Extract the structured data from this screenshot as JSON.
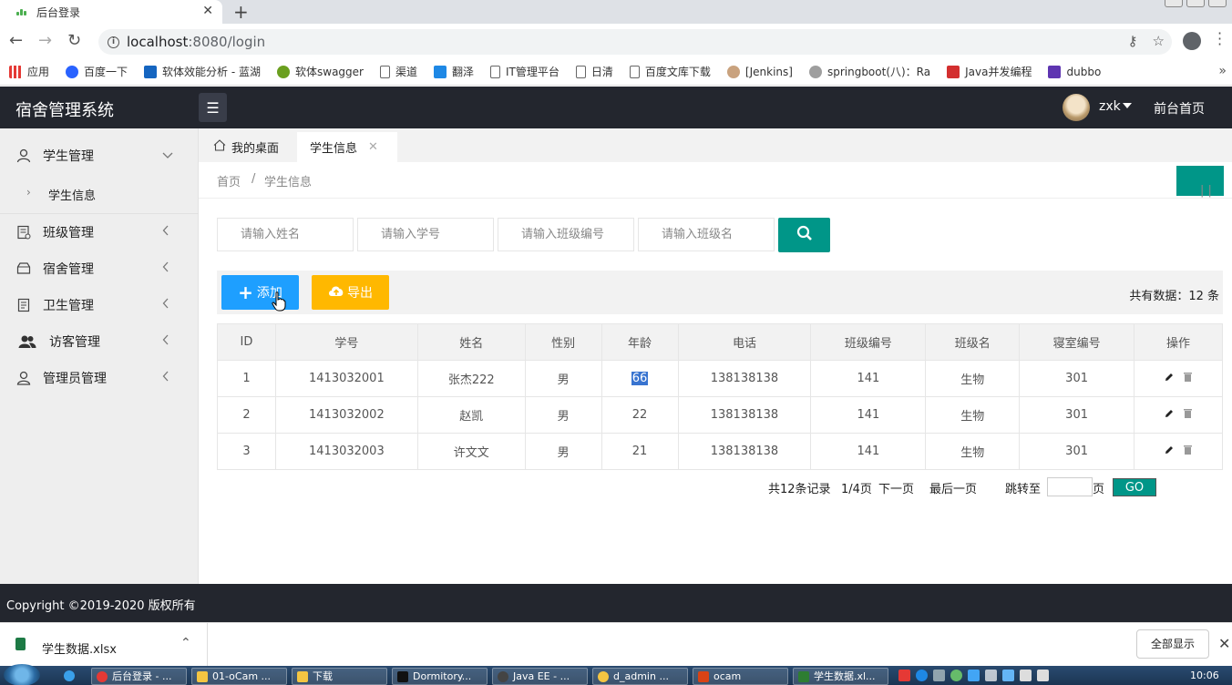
{
  "browser": {
    "tab_title": "后台登录",
    "url_host": "localhost",
    "url_rest": ":8080/login",
    "bookmarks": [
      "应用",
      "百度一下",
      "软体效能分析 - 蓝湖",
      "软体swagger",
      "渠道",
      "翻泽",
      "IT管理平台",
      "日清",
      "百度文库下载",
      "[Jenkins]",
      "springboot(八)：Ra",
      "Java并发编程",
      "dubbo"
    ]
  },
  "header": {
    "title": "宿舍管理系统",
    "username": "zxk",
    "front_link": "前台首页"
  },
  "sidebar": {
    "items": [
      {
        "label": "学生管理",
        "icon": "user-icon"
      },
      {
        "label": "学生信息",
        "icon": "chevron-right-icon"
      },
      {
        "label": "班级管理",
        "icon": "class-icon"
      },
      {
        "label": "宿舍管理",
        "icon": "dorm-icon"
      },
      {
        "label": "卫生管理",
        "icon": "hygiene-icon"
      },
      {
        "label": "访客管理",
        "icon": "visitors-icon"
      },
      {
        "label": "管理员管理",
        "icon": "admin-icon"
      }
    ]
  },
  "tabs": {
    "home": "我的桌面",
    "current": "学生信息"
  },
  "breadcrumb": {
    "home": "首页",
    "sep": "/",
    "current": "学生信息"
  },
  "search": {
    "name_placeholder": "请输入姓名",
    "id_placeholder": "请输入学号",
    "class_no_placeholder": "请输入班级编号",
    "class_name_placeholder": "请输入班级名"
  },
  "toolbar": {
    "add_label": "添加",
    "export_label": "导出",
    "total": "共有数据：12 条"
  },
  "table": {
    "columns": [
      "ID",
      "学号",
      "姓名",
      "性别",
      "年龄",
      "电话",
      "班级编号",
      "班级名",
      "寝室编号",
      "操作"
    ],
    "rows": [
      {
        "id": "1",
        "sno": "1413032001",
        "name": "张杰222",
        "gender": "男",
        "age": "66",
        "phone": "138138138",
        "class_no": "141",
        "class_name": "生物",
        "room": "301"
      },
      {
        "id": "2",
        "sno": "1413032002",
        "name": "赵凯",
        "gender": "男",
        "age": "22",
        "phone": "138138138",
        "class_no": "141",
        "class_name": "生物",
        "room": "301"
      },
      {
        "id": "3",
        "sno": "1413032003",
        "name": "许文文",
        "gender": "男",
        "age": "21",
        "phone": "138138138",
        "class_no": "141",
        "class_name": "生物",
        "room": "301"
      }
    ]
  },
  "pager": {
    "records": "共12条记录",
    "page": "1/4页",
    "next": "下一页",
    "last": "最后一页",
    "jump": "跳转至",
    "page_unit": "页",
    "go": "GO"
  },
  "footer": {
    "copyright": "Copyright ©2019-2020 版权所有"
  },
  "downloads": {
    "file": "学生数据.xlsx",
    "show_all": "全部显示"
  },
  "taskbar": {
    "buttons": [
      "后台登录 - ...",
      "01-oCam ...",
      "下载",
      "Dormitory...",
      "Java EE - ...",
      "d_admin ...",
      "ocam",
      "学生数据.xl..."
    ],
    "clock": "10:06"
  },
  "colors": {
    "header_bg": "#23262e",
    "teal": "#009688",
    "blue": "#1e9fff",
    "orange": "#ffb800"
  }
}
